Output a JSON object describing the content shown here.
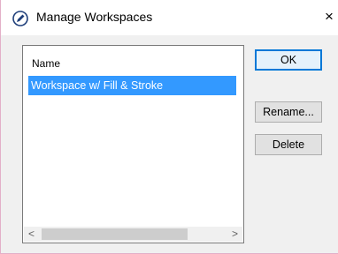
{
  "dialog": {
    "title": "Manage Workspaces",
    "close_label": "×"
  },
  "list": {
    "header": "Name",
    "items": [
      {
        "label": "Workspace w/ Fill & Stroke",
        "selected": true
      }
    ]
  },
  "scrollbar": {
    "left_arrow": "<",
    "right_arrow": ">"
  },
  "buttons": {
    "ok": "OK",
    "rename": "Rename...",
    "delete": "Delete"
  },
  "colors": {
    "selection": "#3399ff",
    "default_button_border": "#0078d7"
  },
  "icons": {
    "title": "pen-circle-icon"
  }
}
